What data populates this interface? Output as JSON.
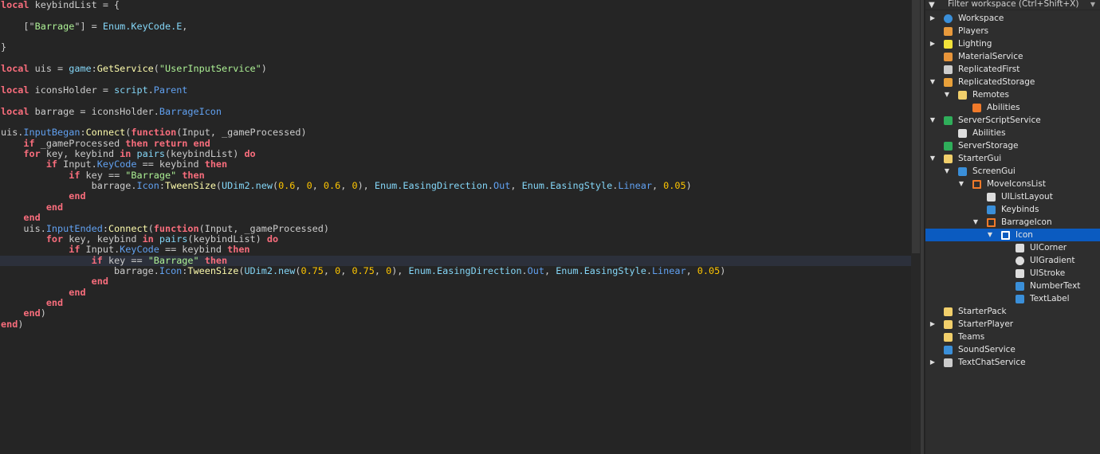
{
  "editor": {
    "highlighted_line": 25,
    "lines": [
      [
        [
          "k",
          "local"
        ],
        [
          "t",
          " keybindList = {"
        ]
      ],
      [],
      [
        [
          "t",
          "    [\""
        ],
        [
          "s",
          "Barrage"
        ],
        [
          "t",
          "\"] = "
        ],
        [
          "b",
          "Enum.KeyCode.E"
        ],
        [
          "t",
          ","
        ]
      ],
      [],
      [
        [
          "t",
          "}"
        ]
      ],
      [],
      [
        [
          "k",
          "local"
        ],
        [
          "t",
          " uis = "
        ],
        [
          "b",
          "game"
        ],
        [
          "t",
          ":"
        ],
        [
          "m",
          "GetService"
        ],
        [
          "t",
          "("
        ],
        [
          "s",
          "\"UserInputService\""
        ],
        [
          "t",
          ")"
        ]
      ],
      [],
      [
        [
          "k",
          "local"
        ],
        [
          "t",
          " iconsHolder = "
        ],
        [
          "b",
          "script"
        ],
        [
          "t",
          "."
        ],
        [
          "p",
          "Parent"
        ]
      ],
      [],
      [
        [
          "k",
          "local"
        ],
        [
          "t",
          " barrage = iconsHolder."
        ],
        [
          "p",
          "BarrageIcon"
        ]
      ],
      [],
      [
        [
          "t",
          "uis."
        ],
        [
          "p",
          "InputBegan"
        ],
        [
          "t",
          ":"
        ],
        [
          "m",
          "Connect"
        ],
        [
          "t",
          "("
        ],
        [
          "k",
          "function"
        ],
        [
          "t",
          "(Input, _gameProcessed)"
        ]
      ],
      [
        [
          "t",
          "    "
        ],
        [
          "k",
          "if"
        ],
        [
          "t",
          " _gameProcessed "
        ],
        [
          "k",
          "then return end"
        ]
      ],
      [
        [
          "t",
          "    "
        ],
        [
          "k",
          "for"
        ],
        [
          "t",
          " key, keybind "
        ],
        [
          "k",
          "in"
        ],
        [
          "t",
          " "
        ],
        [
          "b",
          "pairs"
        ],
        [
          "t",
          "(keybindList) "
        ],
        [
          "k",
          "do"
        ]
      ],
      [
        [
          "t",
          "        "
        ],
        [
          "k",
          "if"
        ],
        [
          "t",
          " Input."
        ],
        [
          "p",
          "KeyCode"
        ],
        [
          "t",
          " == keybind "
        ],
        [
          "k",
          "then"
        ]
      ],
      [
        [
          "t",
          "            "
        ],
        [
          "k",
          "if"
        ],
        [
          "t",
          " key == "
        ],
        [
          "s",
          "\"Barrage\""
        ],
        [
          "t",
          " "
        ],
        [
          "k",
          "then"
        ]
      ],
      [
        [
          "t",
          "                barrage."
        ],
        [
          "p",
          "Icon"
        ],
        [
          "t",
          ":"
        ],
        [
          "m",
          "TweenSize"
        ],
        [
          "t",
          "("
        ],
        [
          "b",
          "UDim2.new"
        ],
        [
          "t",
          "("
        ],
        [
          "n",
          "0.6"
        ],
        [
          "t",
          ", "
        ],
        [
          "n",
          "0"
        ],
        [
          "t",
          ", "
        ],
        [
          "n",
          "0.6"
        ],
        [
          "t",
          ", "
        ],
        [
          "n",
          "0"
        ],
        [
          "t",
          "), "
        ],
        [
          "b",
          "Enum.EasingDirection"
        ],
        [
          "t",
          "."
        ],
        [
          "p",
          "Out"
        ],
        [
          "t",
          ", "
        ],
        [
          "b",
          "Enum.EasingStyle"
        ],
        [
          "t",
          "."
        ],
        [
          "p",
          "Linear"
        ],
        [
          "t",
          ", "
        ],
        [
          "n",
          "0.05"
        ],
        [
          "t",
          ")"
        ]
      ],
      [
        [
          "t",
          "            "
        ],
        [
          "k",
          "end"
        ]
      ],
      [
        [
          "t",
          "        "
        ],
        [
          "k",
          "end"
        ]
      ],
      [
        [
          "t",
          "    "
        ],
        [
          "k",
          "end"
        ]
      ],
      [
        [
          "t",
          "    uis."
        ],
        [
          "p",
          "InputEnded"
        ],
        [
          "t",
          ":"
        ],
        [
          "m",
          "Connect"
        ],
        [
          "t",
          "("
        ],
        [
          "k",
          "function"
        ],
        [
          "t",
          "(Input, _gameProcessed)"
        ]
      ],
      [
        [
          "t",
          "        "
        ],
        [
          "k",
          "for"
        ],
        [
          "t",
          " key, keybind "
        ],
        [
          "k",
          "in"
        ],
        [
          "t",
          " "
        ],
        [
          "b",
          "pairs"
        ],
        [
          "t",
          "(keybindList) "
        ],
        [
          "k",
          "do"
        ]
      ],
      [
        [
          "t",
          "            "
        ],
        [
          "k",
          "if"
        ],
        [
          "t",
          " Input."
        ],
        [
          "p",
          "KeyCode"
        ],
        [
          "t",
          " == keybind "
        ],
        [
          "k",
          "then"
        ]
      ],
      [
        [
          "t",
          "                "
        ],
        [
          "k",
          "if"
        ],
        [
          "t",
          " key == "
        ],
        [
          "s",
          "\"Barrage\""
        ],
        [
          "t",
          " "
        ],
        [
          "k",
          "then"
        ]
      ],
      [
        [
          "t",
          "                    barrage."
        ],
        [
          "p",
          "Icon"
        ],
        [
          "t",
          ":"
        ],
        [
          "m",
          "TweenSize"
        ],
        [
          "t",
          "("
        ],
        [
          "b",
          "UDim2.new"
        ],
        [
          "t",
          "("
        ],
        [
          "n",
          "0.75"
        ],
        [
          "t",
          ", "
        ],
        [
          "n",
          "0"
        ],
        [
          "t",
          ", "
        ],
        [
          "n",
          "0.75"
        ],
        [
          "t",
          ", "
        ],
        [
          "n",
          "0"
        ],
        [
          "t",
          "), "
        ],
        [
          "b",
          "Enum.EasingDirection"
        ],
        [
          "t",
          "."
        ],
        [
          "p",
          "Out"
        ],
        [
          "t",
          ", "
        ],
        [
          "b",
          "Enum.EasingStyle"
        ],
        [
          "t",
          "."
        ],
        [
          "p",
          "Linear"
        ],
        [
          "t",
          ", "
        ],
        [
          "n",
          "0.05"
        ],
        [
          "t",
          ")"
        ]
      ],
      [
        [
          "t",
          "                "
        ],
        [
          "k",
          "end"
        ]
      ],
      [
        [
          "t",
          "            "
        ],
        [
          "k",
          "end"
        ]
      ],
      [
        [
          "t",
          "        "
        ],
        [
          "k",
          "end"
        ]
      ],
      [
        [
          "t",
          "    "
        ],
        [
          "k",
          "end"
        ],
        [
          "t",
          ")"
        ]
      ],
      [
        [
          "k",
          "end"
        ],
        [
          "t",
          ")"
        ]
      ]
    ]
  },
  "explorer": {
    "filter_placeholder": "Filter workspace (Ctrl+Shift+X)",
    "items": [
      {
        "label": "Workspace",
        "level": 0,
        "arrow": "collapsed",
        "icon": "globe-icon",
        "color": "#3a8fd9"
      },
      {
        "label": "Players",
        "level": 0,
        "arrow": "none",
        "icon": "players-icon",
        "color": "#e89a3c"
      },
      {
        "label": "Lighting",
        "level": 0,
        "arrow": "collapsed",
        "icon": "lightbulb-icon",
        "color": "#f2e23a"
      },
      {
        "label": "MaterialService",
        "level": 0,
        "arrow": "none",
        "icon": "material-service-icon",
        "color": "#e8953a"
      },
      {
        "label": "ReplicatedFirst",
        "level": 0,
        "arrow": "none",
        "icon": "replicated-first-icon",
        "color": "#cccccc"
      },
      {
        "label": "ReplicatedStorage",
        "level": 0,
        "arrow": "expanded",
        "icon": "replicated-storage-icon",
        "color": "#e8a03a"
      },
      {
        "label": "Remotes",
        "level": 1,
        "arrow": "expanded",
        "icon": "folder-icon",
        "color": "#f1cf6b"
      },
      {
        "label": "Abilities",
        "level": 2,
        "arrow": "none",
        "icon": "remote-event-icon",
        "color": "#f07a2a"
      },
      {
        "label": "ServerScriptService",
        "level": 0,
        "arrow": "expanded",
        "icon": "server-script-service-icon",
        "color": "#2fae5a"
      },
      {
        "label": "Abilities",
        "level": 1,
        "arrow": "none",
        "icon": "script-icon",
        "color": "#dddddd"
      },
      {
        "label": "ServerStorage",
        "level": 0,
        "arrow": "none",
        "icon": "server-storage-icon",
        "color": "#2fae5a"
      },
      {
        "label": "StarterGui",
        "level": 0,
        "arrow": "expanded",
        "icon": "starter-gui-icon",
        "color": "#f1cf6b"
      },
      {
        "label": "ScreenGui",
        "level": 1,
        "arrow": "expanded",
        "icon": "screen-gui-icon",
        "color": "#3a8fd9"
      },
      {
        "label": "MoveIconsList",
        "level": 2,
        "arrow": "expanded",
        "icon": "frame-icon",
        "color": "#f07a2a"
      },
      {
        "label": "UIListLayout",
        "level": 3,
        "arrow": "none",
        "icon": "list-layout-icon",
        "color": "#dddddd"
      },
      {
        "label": "Keybinds",
        "level": 3,
        "arrow": "none",
        "icon": "local-script-icon",
        "color": "#3a8fd9"
      },
      {
        "label": "BarrageIcon",
        "level": 3,
        "arrow": "expanded",
        "icon": "frame-icon",
        "color": "#f07a2a"
      },
      {
        "label": "Icon",
        "level": 4,
        "arrow": "expanded",
        "icon": "image-label-icon",
        "color": "#ffffff",
        "selected": true
      },
      {
        "label": "UICorner",
        "level": 5,
        "arrow": "none",
        "icon": "ui-corner-icon",
        "color": "#dddddd"
      },
      {
        "label": "UIGradient",
        "level": 5,
        "arrow": "none",
        "icon": "ui-gradient-icon",
        "color": "#dddddd"
      },
      {
        "label": "UIStroke",
        "level": 5,
        "arrow": "none",
        "icon": "ui-stroke-icon",
        "color": "#dddddd"
      },
      {
        "label": "NumberText",
        "level": 5,
        "arrow": "none",
        "icon": "text-label-icon",
        "color": "#3a8fd9"
      },
      {
        "label": "TextLabel",
        "level": 5,
        "arrow": "none",
        "icon": "text-label-icon",
        "color": "#3a8fd9"
      },
      {
        "label": "StarterPack",
        "level": 0,
        "arrow": "none",
        "icon": "starter-pack-icon",
        "color": "#f1cf6b"
      },
      {
        "label": "StarterPlayer",
        "level": 0,
        "arrow": "collapsed",
        "icon": "starter-player-icon",
        "color": "#f1cf6b"
      },
      {
        "label": "Teams",
        "level": 0,
        "arrow": "none",
        "icon": "teams-icon",
        "color": "#f1cf6b"
      },
      {
        "label": "SoundService",
        "level": 0,
        "arrow": "none",
        "icon": "sound-service-icon",
        "color": "#3a8fd9"
      },
      {
        "label": "TextChatService",
        "level": 0,
        "arrow": "collapsed",
        "icon": "text-chat-service-icon",
        "color": "#cccccc"
      }
    ]
  }
}
